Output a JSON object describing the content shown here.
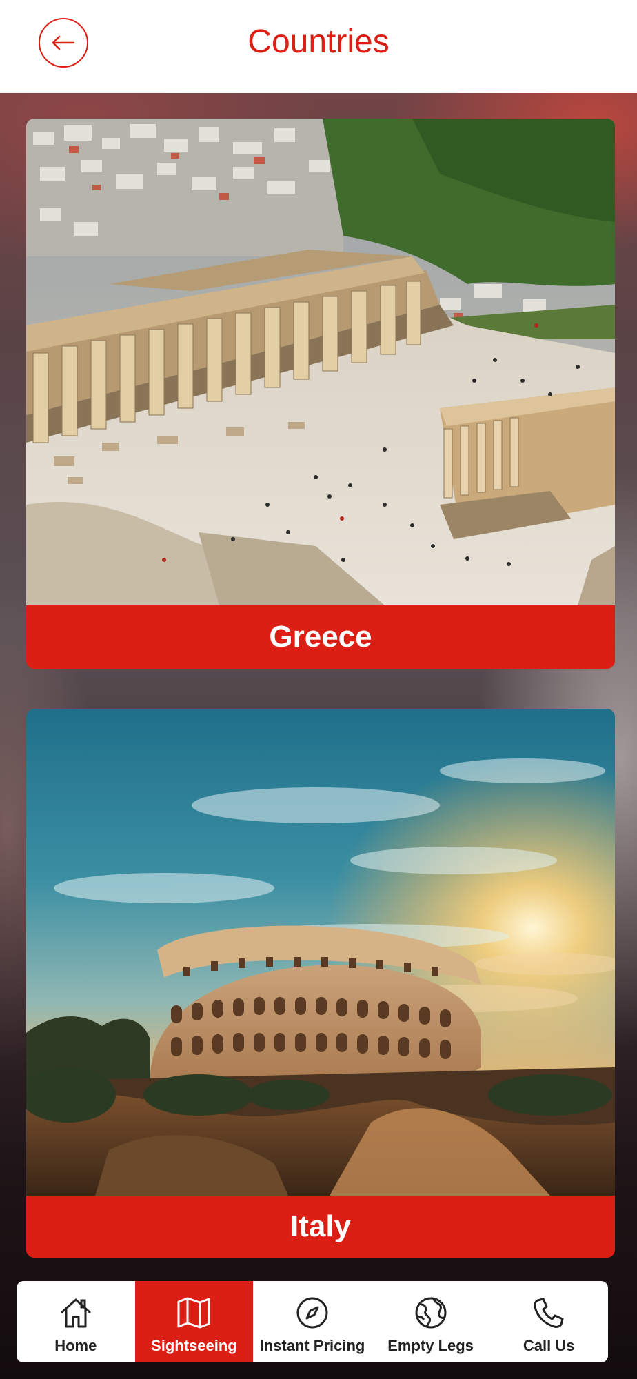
{
  "header": {
    "title": "Countries",
    "back_icon": "arrow-left-icon"
  },
  "colors": {
    "brand_red": "#dc1f15",
    "header_bg": "#ffffff",
    "tab_text": "#222222"
  },
  "countries": [
    {
      "label": "Greece",
      "image": "acropolis-parthenon-photo"
    },
    {
      "label": "Italy",
      "image": "colosseum-sunset-photo"
    }
  ],
  "tabbar": {
    "active": "Sightseeing",
    "tabs": [
      {
        "label": "Home",
        "icon": "home-icon"
      },
      {
        "label": "Sightseeing",
        "icon": "map-icon"
      },
      {
        "label": "Instant Pricing",
        "icon": "compass-icon"
      },
      {
        "label": "Empty Legs",
        "icon": "globe-icon"
      },
      {
        "label": "Call Us",
        "icon": "phone-icon"
      }
    ]
  }
}
